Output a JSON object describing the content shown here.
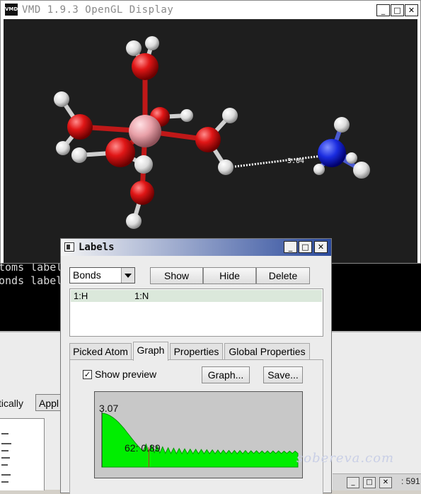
{
  "console": {
    "lines": [
      "toms label",
      "onds label"
    ]
  },
  "background": {
    "partial_label": "tically",
    "apply_button": "Appl",
    "status_coord": ": 591"
  },
  "vmd_window": {
    "title": "VMD 1.9.3 OpenGL Display",
    "icon": "vmd-app-icon",
    "icon_text": "VMD",
    "bond_label": "3.04"
  },
  "labels_dialog": {
    "title": "Labels",
    "type_select": {
      "selected": "Bonds"
    },
    "buttons": {
      "show": "Show",
      "hide": "Hide",
      "delete": "Delete"
    },
    "list": {
      "rows": [
        {
          "atom1": "1:H",
          "atom2": "1:N"
        }
      ]
    },
    "tabs": [
      "Picked Atom",
      "Graph",
      "Properties",
      "Global Properties"
    ],
    "active_tab": "Graph",
    "graph": {
      "show_preview_label": "Show preview",
      "show_preview_checked": true,
      "graph_button": "Graph...",
      "save_button": "Save...",
      "max_label": "3.07",
      "cursor_label": "62: 0.89"
    }
  },
  "chart_data": {
    "type": "area",
    "title": "",
    "xlabel": "",
    "ylabel": "",
    "ylim": [
      0,
      3.07
    ],
    "max_value": 3.07,
    "cursor": {
      "frame": 62,
      "value": 0.89
    },
    "series": [
      {
        "values": [
          3.07,
          3.05,
          3.0,
          2.92,
          2.82,
          2.7,
          2.55,
          2.38,
          2.2,
          2.0,
          1.8,
          1.6,
          1.4,
          1.22,
          1.05,
          0.93,
          1.3,
          0.85,
          1.25,
          0.82,
          1.2,
          0.8,
          1.15,
          0.78,
          1.1,
          0.77,
          1.08,
          0.76,
          1.06,
          0.76,
          1.04,
          0.76,
          1.02,
          0.76,
          1.01,
          0.76,
          1.0,
          0.76,
          0.99,
          0.76,
          0.98,
          0.76,
          0.97,
          0.76,
          0.96,
          0.76,
          0.95,
          0.76,
          0.95,
          0.76,
          0.94,
          0.76,
          0.94,
          0.76,
          0.93,
          0.77,
          0.93,
          0.77,
          0.92,
          0.77,
          0.92,
          0.77,
          0.92,
          0.77,
          0.92,
          0.77,
          0.91,
          0.78,
          0.91,
          0.78,
          0.91,
          0.78
        ]
      }
    ]
  },
  "colors": {
    "curve": "#00ee00",
    "cursor": "#c03030",
    "plot_bg": "#c8c8c8",
    "viewport_bg": "#1e1e1e"
  },
  "watermark": "sobereva.com"
}
